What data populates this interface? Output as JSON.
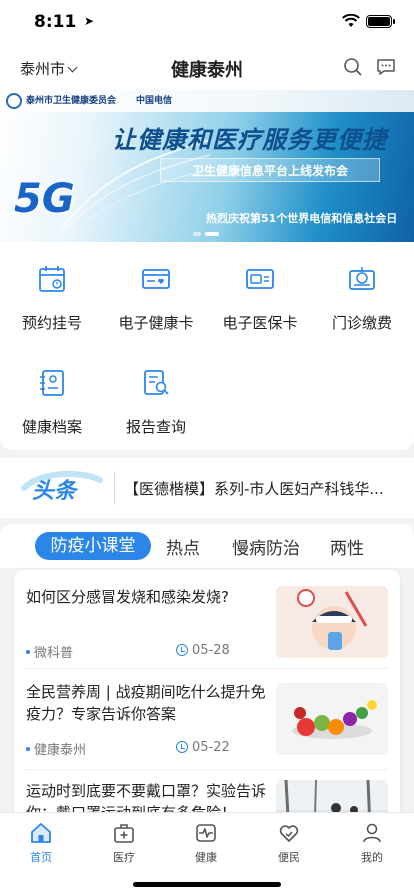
{
  "status": {
    "time": "8:11"
  },
  "nav": {
    "city": "泰州市",
    "title": "健康泰州"
  },
  "banner": {
    "org": "泰州市卫生健康委员会",
    "telecom": "中国电信",
    "headline": "让健康和医疗服务更便捷",
    "subtitle": "卫生健康信息平台上线发布会",
    "footer": "热烈庆祝第51个世界电信和信息社会日",
    "badge": "5G"
  },
  "services": [
    {
      "label": "预约挂号",
      "icon": "calendar-icon"
    },
    {
      "label": "电子健康卡",
      "icon": "health-card-icon"
    },
    {
      "label": "电子医保卡",
      "icon": "insurance-card-icon"
    },
    {
      "label": "门诊缴费",
      "icon": "payment-icon"
    },
    {
      "label": "健康档案",
      "icon": "health-record-icon"
    },
    {
      "label": "报告查询",
      "icon": "report-search-icon"
    }
  ],
  "headlines": {
    "logo": "头条",
    "text": "【医德楷模】系列-市人医妇产科钱华..."
  },
  "tabs": [
    "防疫小课堂",
    "热点",
    "慢病防治",
    "两性"
  ],
  "articles": [
    {
      "title": "如何区分感冒发烧和感染发烧?",
      "source": "微科普",
      "date": "05-28"
    },
    {
      "title": "全民营养周 | 战疫期间吃什么提升免疫力？专家告诉你答案",
      "source": "健康泰州",
      "date": "05-22"
    },
    {
      "title": "运动时到底要不要戴口罩？实验告诉你：戴口罩运动到底有多危险！",
      "source": "",
      "date": ""
    }
  ],
  "tabbar": [
    {
      "label": "首页",
      "icon": "home-icon",
      "active": true
    },
    {
      "label": "医疗",
      "icon": "medical-kit-icon",
      "active": false
    },
    {
      "label": "健康",
      "icon": "heartbeat-icon",
      "active": false
    },
    {
      "label": "便民",
      "icon": "heart-hand-icon",
      "active": false
    },
    {
      "label": "我的",
      "icon": "user-icon",
      "active": false
    }
  ],
  "colors": {
    "accent": "#2b86e8",
    "background": "#f2f3f5"
  }
}
